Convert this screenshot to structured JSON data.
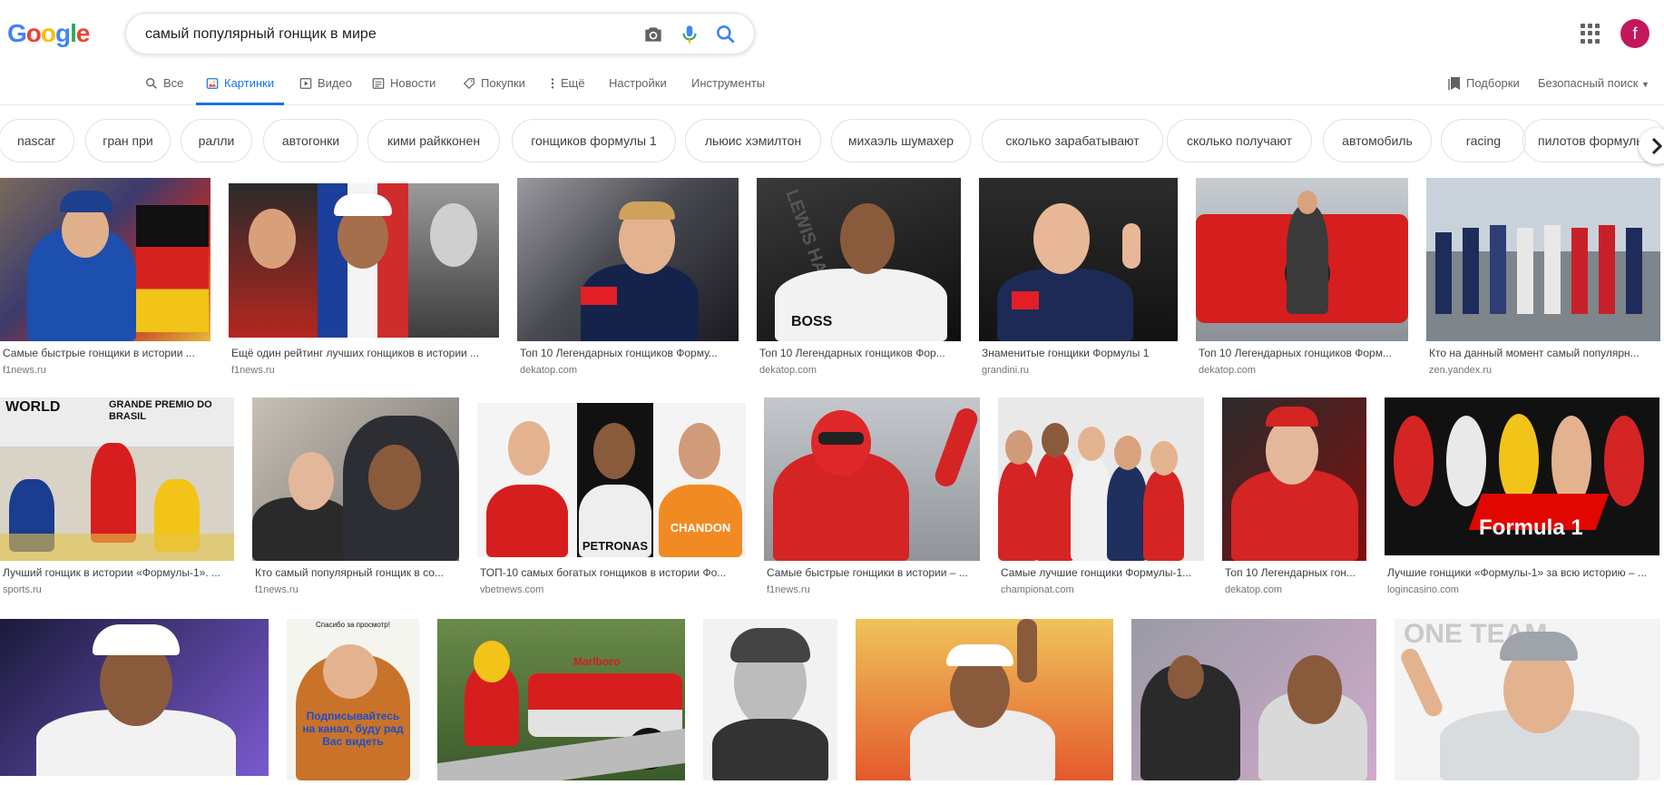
{
  "header": {
    "logo_letters": [
      "G",
      "o",
      "o",
      "g",
      "l",
      "e"
    ],
    "query": "самый популярный гонщик в мире",
    "avatar_letter": "f"
  },
  "tabs": [
    {
      "label": "Все",
      "icon": "search-icon"
    },
    {
      "label": "Картинки",
      "icon": "image-icon",
      "active": true
    },
    {
      "label": "Видео",
      "icon": "video-icon"
    },
    {
      "label": "Новости",
      "icon": "news-icon"
    },
    {
      "label": "Покупки",
      "icon": "tag-icon"
    },
    {
      "label": "Ещё",
      "icon": "more-vert-icon"
    },
    {
      "label": "Настройки"
    },
    {
      "label": "Инструменты"
    }
  ],
  "right_links": {
    "collections": "Подборки",
    "safe_search": "Безопасный поиск"
  },
  "chips": [
    "nascar",
    "гран при",
    "ралли",
    "автогонки",
    "кими райкконен",
    "гонщиков формулы 1",
    "льюис хэмилтон",
    "михаэль шумахер",
    "сколько зарабатывают",
    "сколько получают",
    "автомобиль",
    "racing",
    "пилотов формулы"
  ],
  "results": [
    {
      "caption": "Самые быстрые гонщики в истории ...",
      "domain": "f1news.ru"
    },
    {
      "caption": "Ещё один рейтинг лучших гонщиков в истории ...",
      "domain": "f1news.ru"
    },
    {
      "caption": "Топ 10 Легендарных гонщиков Форму...",
      "domain": "dekatop.com"
    },
    {
      "caption": "Топ 10 Легендарных гонщиков Фор...",
      "domain": "dekatop.com"
    },
    {
      "caption": "Знаменитые гонщики Формулы 1",
      "domain": "grandini.ru"
    },
    {
      "caption": "Топ 10 Легендарных гонщиков Форм...",
      "domain": "dekatop.com"
    },
    {
      "caption": "Кто на данный момент самый популярн...",
      "domain": "zen.yandex.ru"
    },
    {
      "caption": "Лучший гонщик в истории «Формулы-1». ...",
      "domain": "sports.ru"
    },
    {
      "caption": "Кто самый популярный гонщик в со...",
      "domain": "f1news.ru"
    },
    {
      "caption": "ТОП-10 самых богатых гонщиков в истории Фо...",
      "domain": "vbetnews.com"
    },
    {
      "caption": "Самые быстрые гонщики в истории – ...",
      "domain": "f1news.ru"
    },
    {
      "caption": "Самые лучшие гонщики Формулы-1...",
      "domain": "championat.com"
    },
    {
      "caption": "Топ 10 Легендарных гон...",
      "domain": "dekatop.com"
    },
    {
      "caption": "Лучшие гонщики «Формулы-1» за всю историю – ...",
      "domain": "logincasino.com"
    }
  ],
  "image_text": {
    "formula1": "Formula 1",
    "petronas": "PETRONAS",
    "chandon": "CHANDON",
    "world": "WORLD",
    "premio": "GRANDE PREMIO DO BRASIL",
    "subscribe": "Подписывайтесь на канал, буду рад Вас видеть",
    "thanks": "Спасибо за просмотр!",
    "marlboro": "Marlboro",
    "one_team": "ONE TEAM",
    "lewis": "LEWIS HAMILTON"
  },
  "colors": {
    "blue": "#4285f4",
    "red": "#ea4335",
    "yellow": "#fbbc05",
    "green": "#34a853",
    "link": "#1a73e8"
  }
}
